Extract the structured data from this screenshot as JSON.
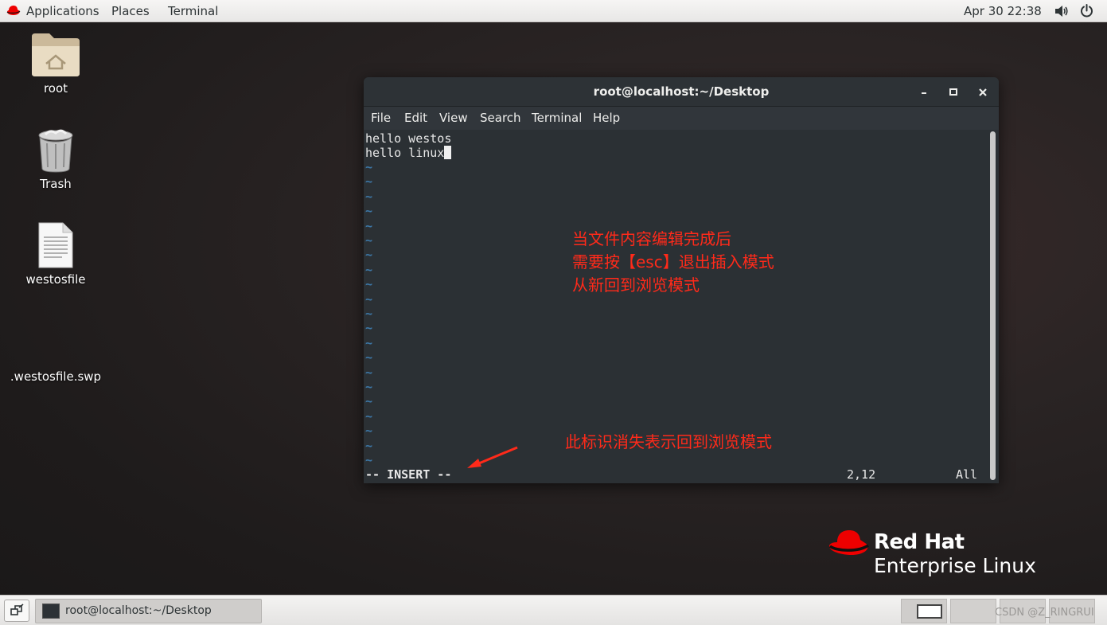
{
  "topbar": {
    "applications": "Applications",
    "places": "Places",
    "terminal": "Terminal",
    "clock": "Apr 30  22:38"
  },
  "desktop": {
    "icons": [
      {
        "label": "root",
        "icon": "home-folder-icon"
      },
      {
        "label": "Trash",
        "icon": "trash-icon"
      },
      {
        "label": "westosfile",
        "icon": "text-file-icon"
      },
      {
        "label": ".westosfile.swp",
        "icon": "none"
      }
    ]
  },
  "terminal_window": {
    "title": "root@localhost:~/Desktop",
    "menu": [
      "File",
      "Edit",
      "View",
      "Search",
      "Terminal",
      "Help"
    ],
    "lines": [
      "hello westos",
      "hello linux"
    ],
    "tilde": "~",
    "status_mode": "-- INSERT --",
    "status_position": "2,12",
    "status_scope": "All"
  },
  "annotations": {
    "note1_lines": [
      "当文件内容编辑完成后",
      "需要按【esc】退出插入模式",
      "从新回到浏览模式"
    ],
    "note2": "此标识消失表示回到浏览模式",
    "color": "#ff2a1a"
  },
  "branding": {
    "line1": "Red Hat",
    "line2": "Enterprise Linux",
    "color": "#ee0000"
  },
  "taskbar": {
    "task_label": "root@localhost:~/Desktop",
    "watermark": "CSDN @Z_RINGRUI"
  }
}
